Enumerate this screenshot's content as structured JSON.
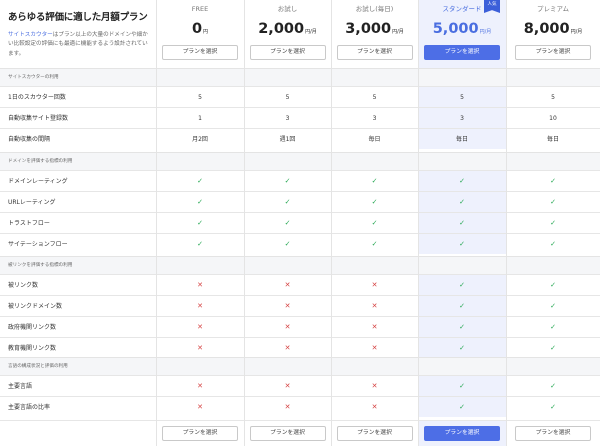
{
  "intro": {
    "title": "あらゆる評価に適した月額プラン",
    "desc_brand": "サイトスカウター",
    "desc_rest": "はプラン以上の大量のドメインや細かい比較設定の評価にも最適に機能するよう設計されています。"
  },
  "plans": [
    {
      "name": "FREE",
      "price": "0",
      "unit": "円",
      "button": "プランを選択",
      "highlight": false
    },
    {
      "name": "お試し",
      "price": "2,000",
      "unit": "円/月",
      "button": "プランを選択",
      "highlight": false
    },
    {
      "name": "お試し(毎日)",
      "price": "3,000",
      "unit": "円/月",
      "button": "プランを選択",
      "highlight": false
    },
    {
      "name": "スタンダード",
      "price": "5,000",
      "unit": "円/月",
      "button": "プランを選択",
      "highlight": true,
      "badge": "人気"
    },
    {
      "name": "プレミアム",
      "price": "8,000",
      "unit": "円/月",
      "button": "プランを選択",
      "highlight": false
    }
  ],
  "sections": [
    {
      "title": "サイトスカウターの利用",
      "rows": [
        {
          "label": "1日のスカウター回数",
          "values": [
            "5",
            "5",
            "5",
            "5",
            "5"
          ]
        },
        {
          "label": "自動収集サイト登録数",
          "values": [
            "1",
            "3",
            "3",
            "3",
            "10"
          ]
        },
        {
          "label": "自動収集の間隔",
          "values": [
            "月2回",
            "週1回",
            "毎日",
            "毎日",
            "毎日"
          ]
        }
      ]
    },
    {
      "title": "ドメインを評価する指標の利用",
      "rows": [
        {
          "label": "ドメインレーティング",
          "values": [
            "check",
            "check",
            "check",
            "check",
            "check"
          ]
        },
        {
          "label": "URLレーティング",
          "values": [
            "check",
            "check",
            "check",
            "check",
            "check"
          ]
        },
        {
          "label": "トラストフロー",
          "values": [
            "check",
            "check",
            "check",
            "check",
            "check"
          ]
        },
        {
          "label": "サイテーションフロー",
          "values": [
            "check",
            "check",
            "check",
            "check",
            "check"
          ]
        }
      ]
    },
    {
      "title": "被リンクを評価する指標の利用",
      "rows": [
        {
          "label": "被リンク数",
          "values": [
            "cross",
            "cross",
            "cross",
            "check",
            "check"
          ]
        },
        {
          "label": "被リンクドメイン数",
          "values": [
            "cross",
            "cross",
            "cross",
            "check",
            "check"
          ]
        },
        {
          "label": "政府機関リンク数",
          "values": [
            "cross",
            "cross",
            "cross",
            "check",
            "check"
          ]
        },
        {
          "label": "教育機関リンク数",
          "values": [
            "cross",
            "cross",
            "cross",
            "check",
            "check"
          ]
        }
      ]
    },
    {
      "title": "言語の構成状況と評価の利用",
      "rows": [
        {
          "label": "主要言語",
          "values": [
            "cross",
            "cross",
            "cross",
            "check",
            "check"
          ]
        },
        {
          "label": "主要言語の比率",
          "values": [
            "cross",
            "cross",
            "cross",
            "check",
            "check"
          ]
        }
      ]
    }
  ],
  "footer_button": "プランを選択",
  "icons": {
    "check": "✓",
    "cross": "✕"
  },
  "colors": {
    "accent": "#4d6ee6",
    "highlight_bg": "#eef1fd",
    "check": "#27a854",
    "cross": "#d64545"
  }
}
